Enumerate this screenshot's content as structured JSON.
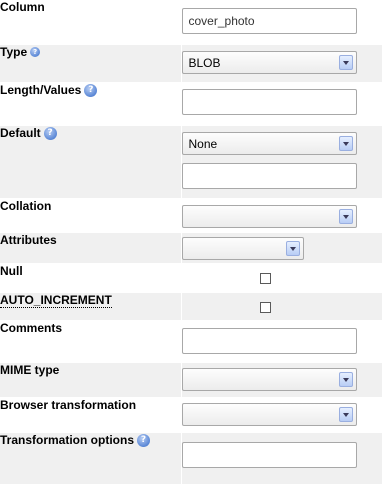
{
  "rows": {
    "column": {
      "label": "Column",
      "value": "cover_photo"
    },
    "type": {
      "label": "Type",
      "value": "BLOB"
    },
    "length": {
      "label": "Length/Values",
      "value": ""
    },
    "default": {
      "label": "Default",
      "value": "None",
      "input_value": ""
    },
    "collation": {
      "label": "Collation",
      "value": ""
    },
    "attributes": {
      "label": "Attributes",
      "value": ""
    },
    "null": {
      "label": "Null",
      "checked": false
    },
    "auto_increment": {
      "label": "AUTO_INCREMENT",
      "checked": false
    },
    "comments": {
      "label": "Comments",
      "value": ""
    },
    "mime_type": {
      "label": "MIME type",
      "value": ""
    },
    "browser_transformation": {
      "label": "Browser transformation",
      "value": ""
    },
    "transformation_options": {
      "label": "Transformation options",
      "value": ""
    }
  },
  "icons": {
    "help": "help-icon",
    "dropdown": "chevron-down-icon"
  },
  "colors": {
    "row_alt": "#f0f0f0",
    "help_icon": "#5a87d6"
  }
}
